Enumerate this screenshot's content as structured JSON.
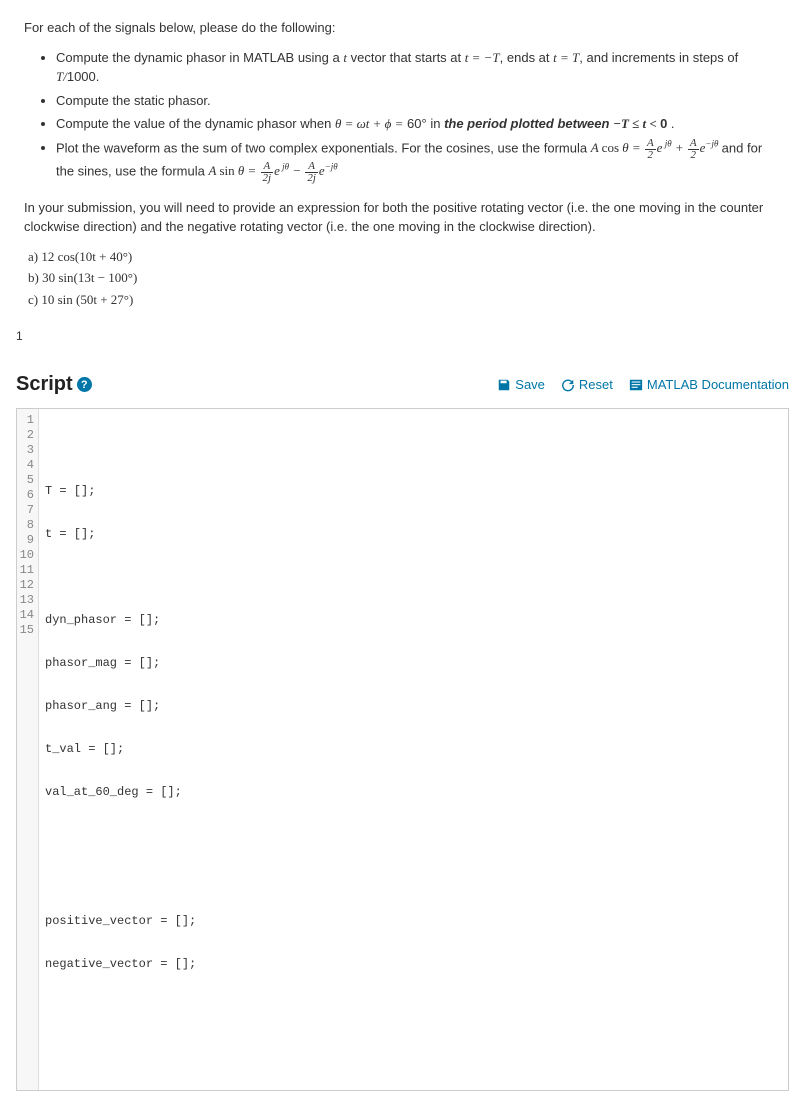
{
  "problem": {
    "intro": "For each of the signals below, please do the following:",
    "bullets": {
      "b1a": "Compute the dynamic phasor in MATLAB using a ",
      "b1b": " vector that starts at ",
      "b1c": ", ends at ",
      "b1d": ", and increments in steps of ",
      "b1e": ".",
      "b2": "Compute the static phasor.",
      "b3a": "Compute the value of the dynamic phasor when ",
      "b3b": " in ",
      "b3c": "the period plotted between ",
      "b3d": " .",
      "b4a": "Plot the waveform as the sum of two complex exponentials.  For the cosines, use the formula ",
      "b4b": " and for the sines, use the formula "
    },
    "submission": "In your submission, you will need to provide an expression for both the positive rotating vector (i.e. the one moving in the counter clockwise direction) and the negative rotating vector (i.e. the one moving in the clockwise direction).",
    "parts": {
      "a": "a)   12 cos(10t + 40°)",
      "b": "b)   30 sin(13t − 100°)",
      "c": "c)   10 sin (50t + 27°)"
    }
  },
  "pageNumber": "1",
  "scriptPanel": {
    "title": "Script",
    "help": "?",
    "save": "Save",
    "reset": "Reset",
    "docs": "MATLAB Documentation"
  },
  "code": {
    "l1": "",
    "l2": "T = [];",
    "l3": "t = [];",
    "l4": "",
    "l5": "dyn_phasor = [];",
    "l6": "phasor_mag = [];",
    "l7": "phasor_ang = [];",
    "l8": "t_val = [];",
    "l9": "val_at_60_deg = [];",
    "l10": "",
    "l11": "",
    "l12": "positive_vector = [];",
    "l13": "negative_vector = [];",
    "l14": "",
    "l15": ""
  },
  "gutter": [
    "1",
    "2",
    "3",
    "4",
    "5",
    "6",
    "7",
    "8",
    "9",
    "10",
    "11",
    "12",
    "13",
    "14",
    "15"
  ]
}
